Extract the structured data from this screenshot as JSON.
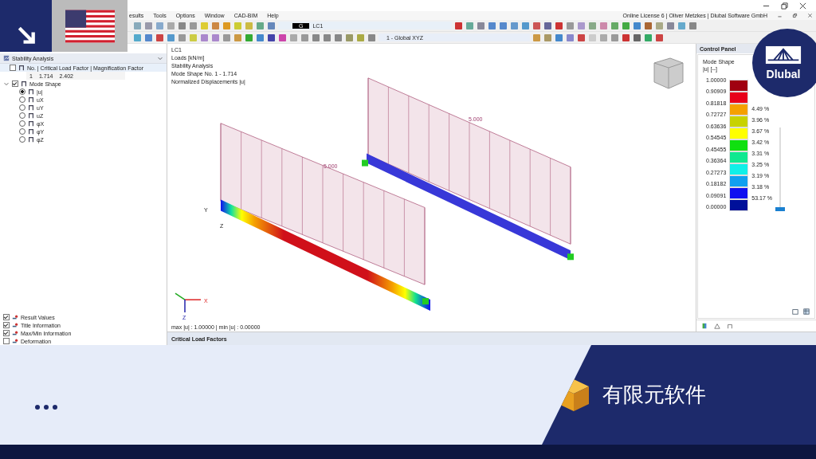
{
  "title_bar": {
    "text": "Online License 6 | Oliver Metzkes | Dlubal Software GmbH"
  },
  "menu": [
    "esults",
    "Tools",
    "Options",
    "Window",
    "CAD-BIM",
    "Help"
  ],
  "toolbar": {
    "load_type": "G",
    "load_case": "LC1",
    "coordinate_system": "1 - Global XYZ"
  },
  "navigator": {
    "title": "Stability Analysis",
    "header": {
      "label": "No. | Critical Load Factor | Magnification Factor",
      "checked": false
    },
    "selector": [
      "1",
      "1.714",
      "2.402"
    ],
    "mode_shape": {
      "label": "Mode Shape",
      "checked": true,
      "expanded": true,
      "options": [
        {
          "label": "|u|",
          "selected": true
        },
        {
          "label": "uX",
          "selected": false
        },
        {
          "label": "uY",
          "selected": false
        },
        {
          "label": "uZ",
          "selected": false
        },
        {
          "label": "φX",
          "selected": false
        },
        {
          "label": "φY",
          "selected": false
        },
        {
          "label": "φZ",
          "selected": false
        }
      ]
    },
    "display_items": [
      {
        "label": "Result Values",
        "checked": true
      },
      {
        "label": "Title Information",
        "checked": true
      },
      {
        "label": "Max/Min Information",
        "checked": true
      },
      {
        "label": "Deformation",
        "checked": false
      }
    ]
  },
  "viewport": {
    "info": [
      "LC1",
      "Loads [kN/m]",
      "Stability Analysis",
      "Mode Shape No. 1 - 1.714",
      "Normalized Displacements |u|"
    ],
    "load_labels": [
      "5.000",
      "5.000"
    ],
    "beam_axes": [
      "Y",
      "Z"
    ],
    "triad_axes": [
      "X",
      "Z"
    ],
    "summary": "max |u| : 1.00000 | min |u| : 0.00000"
  },
  "control_panel": {
    "title": "Control Panel",
    "heading": "Mode Shape",
    "unit": "|u| [--]",
    "scale_values": [
      "1.00000",
      "0.90909",
      "0.81818",
      "0.72727",
      "0.63636",
      "0.54545",
      "0.45455",
      "0.36364",
      "0.27273",
      "0.18182",
      "0.09091",
      "0.00000"
    ],
    "bands": [
      {
        "color": "#a00010"
      },
      {
        "color": "#e8001a"
      },
      {
        "color": "#f5a000",
        "percent": "4.49 %"
      },
      {
        "color": "#c8d200",
        "percent": "3.96 %"
      },
      {
        "color": "#ffff00",
        "percent": "3.67 %"
      },
      {
        "color": "#10e010",
        "percent": "3.42 %"
      },
      {
        "color": "#10e890",
        "percent": "3.31 %"
      },
      {
        "color": "#10f0e8",
        "percent": "3.25 %"
      },
      {
        "color": "#10a0f0",
        "percent": "3.19 %"
      },
      {
        "color": "#1010f0",
        "percent": "3.18 %"
      },
      {
        "color": "#00109a",
        "percent": "53.17 %"
      }
    ],
    "range_slider": {
      "level": 0
    }
  },
  "bottom_panel": {
    "title": "Critical Load Factors"
  },
  "banner": {
    "caption": "有限元软件"
  },
  "logo": {
    "text": "Dlubal"
  }
}
